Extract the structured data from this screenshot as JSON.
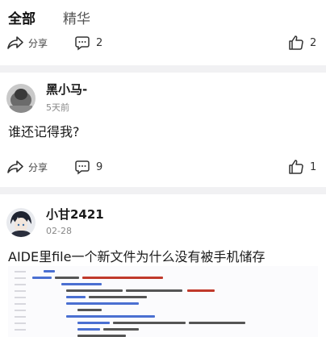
{
  "tabs": {
    "all": "全部",
    "featured": "精华"
  },
  "post1": {
    "share_label": "分享",
    "comment_count": "2",
    "like_count": "2"
  },
  "post2": {
    "author": "黑小马-",
    "time": "5天前",
    "title": "谁还记得我?",
    "share_label": "分享",
    "comment_count": "9",
    "like_count": "1"
  },
  "post3": {
    "author": "小甘2421",
    "time": "02-28",
    "title": "AIDE里file一个新文件为什么没有被手机储存"
  },
  "icons": {
    "share": "share-icon",
    "comment": "comment-icon",
    "like": "like-icon"
  },
  "colors": {
    "divider": "#f1f1f3",
    "code_keyword": "#4a6fd1",
    "code_string": "#c0392b"
  }
}
